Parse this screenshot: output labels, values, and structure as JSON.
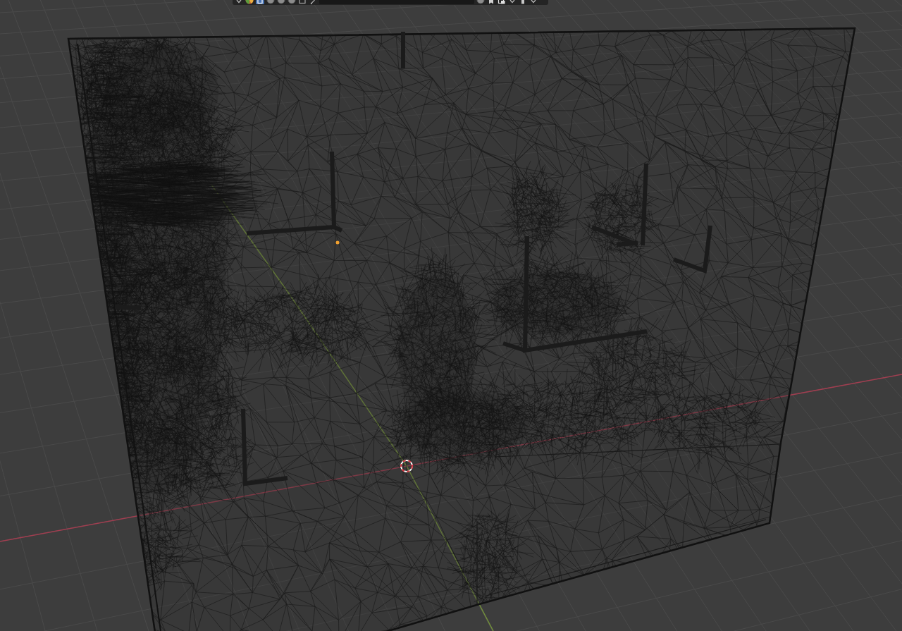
{
  "header": {
    "left_icons": [
      {
        "kind": "caret",
        "selected": false
      },
      {
        "kind": "ball",
        "selected": false
      },
      {
        "kind": "square",
        "selected": true
      },
      {
        "kind": "disc",
        "selected": false
      },
      {
        "kind": "disc",
        "selected": false
      },
      {
        "kind": "disc",
        "selected": false
      },
      {
        "kind": "frame",
        "selected": false
      },
      {
        "kind": "slash",
        "selected": false
      }
    ],
    "right_icons": [
      {
        "kind": "disc",
        "selected": false
      },
      {
        "kind": "bookmark",
        "selected": false
      },
      {
        "kind": "window",
        "selected": false
      },
      {
        "kind": "caret",
        "selected": false
      },
      {
        "kind": "bar",
        "selected": false
      },
      {
        "kind": "caret",
        "selected": false
      }
    ]
  }
}
